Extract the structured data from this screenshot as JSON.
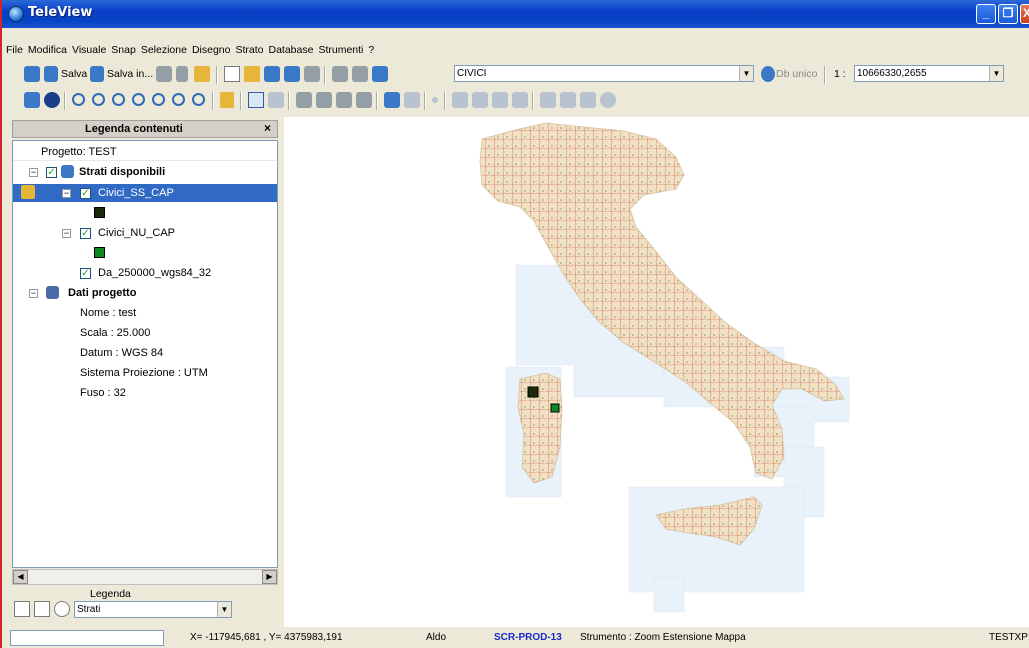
{
  "window": {
    "title": "TeleView",
    "min_glyph": "_",
    "max_glyph": "❐",
    "close_glyph": "X"
  },
  "menu": [
    "File",
    "Modifica",
    "Visuale",
    "Snap",
    "Selezione",
    "Disegno",
    "Strato",
    "Database",
    "Strumenti",
    "?"
  ],
  "toolbar1": {
    "save_label": "Salva",
    "save_as_label": "Salva in...",
    "layer_combo_value": "CIVICI",
    "db_label": "Db unico",
    "scale_prefix": "1 :",
    "scale_value": "10666330,2655"
  },
  "legend_panel": {
    "title": "Legenda contenuti",
    "close": "×",
    "project_label": "Progetto: TEST",
    "layers_group": "Strati disponibili",
    "layers": [
      {
        "name": "Civici_SS_CAP",
        "color": "#1b2a0a",
        "checked": true,
        "selected": true
      },
      {
        "name": "Civici_NU_CAP",
        "color": "#0d8a1f",
        "checked": true,
        "selected": false
      },
      {
        "name": "Da_250000_wgs84_32",
        "checked": true,
        "selected": false
      }
    ],
    "project_group": "Dati progetto",
    "project_props": [
      "Nome : test",
      "Scala : 25.000",
      "Datum : WGS 84",
      "Sistema Proiezione : UTM",
      "Fuso : 32"
    ],
    "footer_title": "Legenda",
    "footer_combo": "Strati"
  },
  "status": {
    "coords": "X= -117945,681 , Y= 4375983,191",
    "user": "Aldo",
    "server": "SCR-PROD-13",
    "tool": "Strumento :  Zoom Estensione Mappa",
    "right": "TESTXP"
  },
  "colors": {
    "selection": "#316ac5",
    "title_bar": "#0a3fc8",
    "map_land": "#f2e3c8",
    "map_tiles": "#e9f1fa",
    "server_text": "#1a2ac8"
  }
}
